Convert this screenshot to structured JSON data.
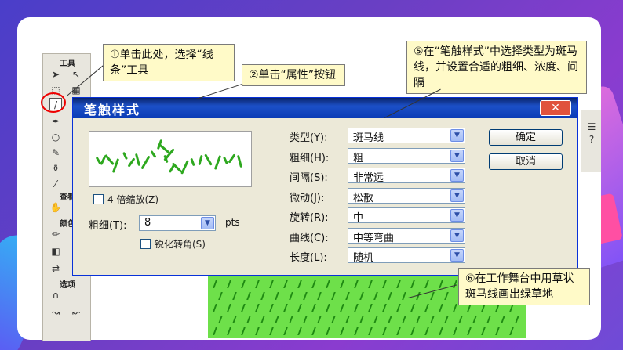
{
  "toolbox": {
    "title_tools": "工具",
    "title_view": "查看",
    "title_colors": "颜色",
    "title_options": "选项"
  },
  "dialog": {
    "title": "笔触样式",
    "close_label": "✕",
    "zoom_checkbox_label": "4 倍缩放(Z)",
    "thickness_label": "粗细(T):",
    "thickness_value": "8",
    "thickness_unit": "pts",
    "sharpen_label": "锐化转角(S)",
    "fields": [
      {
        "label": "类型(Y):",
        "value": "斑马线"
      },
      {
        "label": "粗细(H):",
        "value": "粗"
      },
      {
        "label": "间隔(S):",
        "value": "非常远"
      },
      {
        "label": "微动(J):",
        "value": "松散"
      },
      {
        "label": "旋转(R):",
        "value": "中"
      },
      {
        "label": "曲线(C):",
        "value": "中等弯曲"
      },
      {
        "label": "长度(L):",
        "value": "随机"
      }
    ],
    "ok_label": "确定",
    "cancel_label": "取消"
  },
  "callouts": {
    "c1": "①单击此处，选择“线条”工具",
    "c2": "②单击“属性”按钮",
    "c5": "⑤在“笔触样式”中选择类型为斑马线，并设置合适的粗细、浓度、间隔",
    "c6": "⑥在工作舞台中用草状斑马线画出绿草地"
  },
  "colors": {
    "titlebar": "#0a246a",
    "callout_bg": "#fffac8",
    "grass": "#6ee04a",
    "highlight_ring": "#ee0000"
  }
}
